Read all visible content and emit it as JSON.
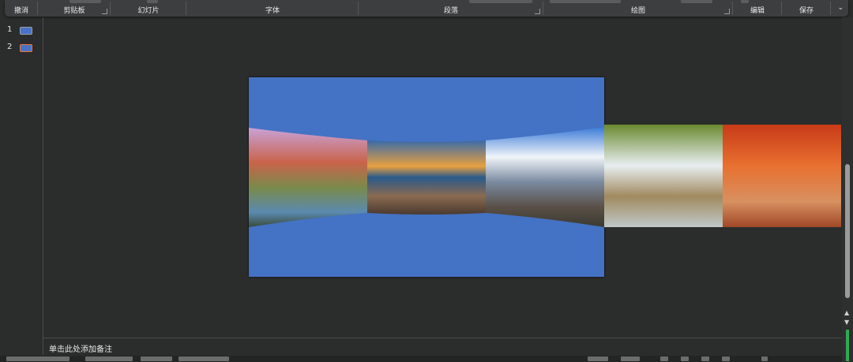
{
  "ribbon": {
    "groups": {
      "undo": "撤消",
      "clipboard": "剪贴板",
      "slides": "幻灯片",
      "font": "字体",
      "paragraph": "段落",
      "drawing": "绘图",
      "editing": "编辑",
      "save": "保存"
    },
    "collapse_icon": "chevron-down-icon"
  },
  "thumbnails": [
    {
      "number": "1",
      "selected": false
    },
    {
      "number": "2",
      "selected": true
    }
  ],
  "notes": {
    "placeholder": "单击此处添加备注"
  },
  "slide": {
    "background_color": "#4472c4",
    "carousel_images": [
      "mountains-river-photo",
      "boardwalk-sunset-photo",
      "alpine-chalet-photo",
      "waterfall-photo",
      "autumn-forest-photo"
    ]
  },
  "colors": {
    "app_background": "#2b2c2c",
    "ribbon": "#3d3e3f",
    "selection_accent": "#e8783c",
    "status_green": "#2faa52"
  }
}
